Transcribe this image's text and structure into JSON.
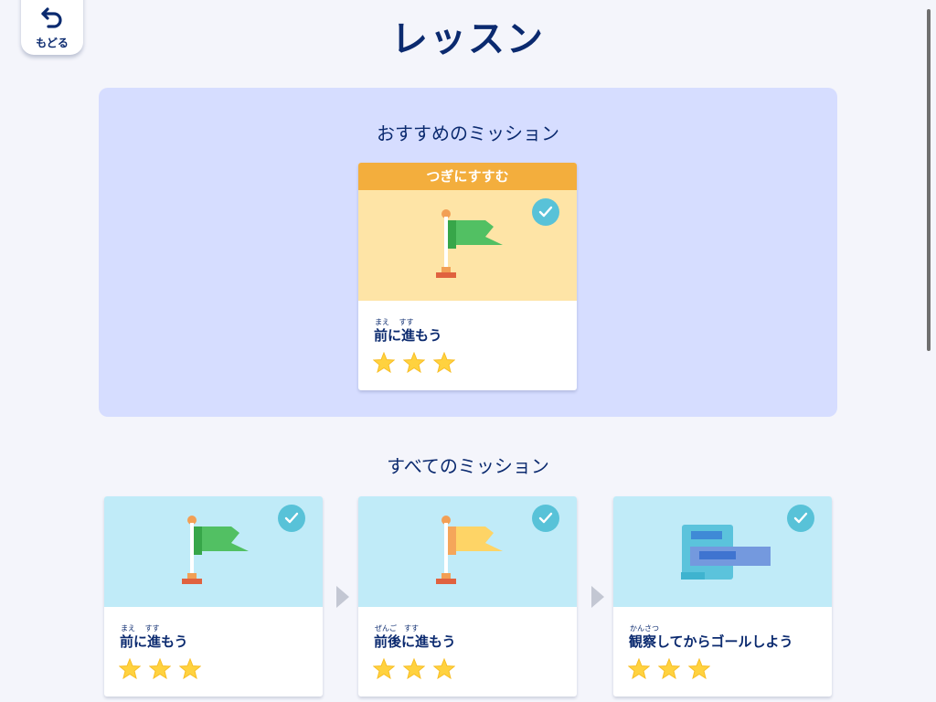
{
  "header": {
    "back_label": "もどる",
    "title": "レッスン"
  },
  "recommended": {
    "section_title": "おすすめのミッション",
    "card": {
      "banner": "つぎにすすむ",
      "ruby": "まえ　 すす",
      "name": "前に進もう",
      "stars": 3,
      "completed": true,
      "icon": "green-flag-icon"
    }
  },
  "all_missions": {
    "section_title": "すべてのミッション",
    "cards": [
      {
        "ruby": "まえ　 すす",
        "name": "前に進もう",
        "stars": 3,
        "completed": true,
        "icon": "green-flag-icon"
      },
      {
        "ruby": "ぜんご　すす",
        "name": "前後に進もう",
        "stars": 3,
        "completed": true,
        "icon": "yellow-flag-icon"
      },
      {
        "ruby": "かんさつ",
        "name": "観察してからゴールしよう",
        "stars": 3,
        "completed": true,
        "icon": "blocks-icon"
      }
    ]
  },
  "colors": {
    "title": "#0b2a6f",
    "panel": "#d6ddff",
    "banner": "#f3ae3d",
    "check": "#58c2d8",
    "star": "#ffd23f"
  }
}
